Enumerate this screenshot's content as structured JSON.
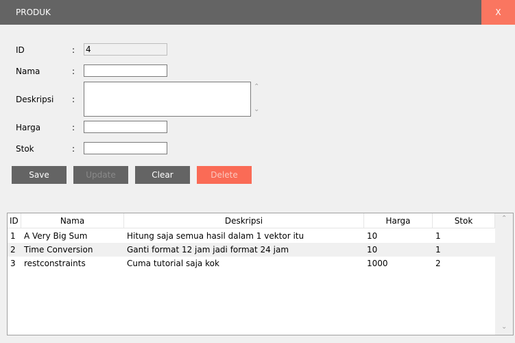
{
  "window": {
    "title": "PRODUK",
    "close_label": "X"
  },
  "form": {
    "id_label": "ID",
    "id_value": "4",
    "nama_label": "Nama",
    "nama_value": "",
    "deskripsi_label": "Deskripsi",
    "deskripsi_value": "",
    "harga_label": "Harga",
    "harga_value": "",
    "stok_label": "Stok",
    "stok_value": "",
    "colon": ":"
  },
  "buttons": {
    "save": "Save",
    "update": "Update",
    "clear": "Clear",
    "delete": "Delete"
  },
  "table": {
    "headers": [
      "ID",
      "Nama",
      "Deskripsi",
      "Harga",
      "Stok"
    ],
    "rows": [
      {
        "id": "1",
        "nama": "A Very Big Sum",
        "deskripsi": "Hitung saja semua hasil dalam 1 vektor itu",
        "harga": "10",
        "stok": "1"
      },
      {
        "id": "2",
        "nama": "Time Conversion",
        "deskripsi": "Ganti format 12 jam jadi format 24 jam",
        "harga": "10",
        "stok": "1"
      },
      {
        "id": "3",
        "nama": "restconstraints",
        "deskripsi": "Cuma tutorial saja kok",
        "harga": "1000",
        "stok": "2"
      }
    ]
  },
  "colors": {
    "titlebar": "#646464",
    "close": "#fa7660",
    "button": "#646464",
    "delete": "#fa6b56"
  }
}
